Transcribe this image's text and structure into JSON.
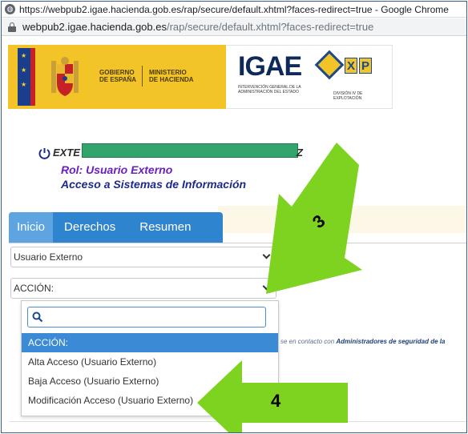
{
  "window": {
    "title": "https://webpub2.igae.hacienda.gob.es/rap/secure/default.xhtml?faces-redirect=true - Google Chrome"
  },
  "address": {
    "host": "webpub2.igae.hacienda.gob.es",
    "path": "/rap/secure/default.xhtml?faces-redirect=true"
  },
  "banner": {
    "gov_line1": "GOBIERNO",
    "gov_line2": "DE ESPAÑA",
    "min_line1": "MINISTERIO",
    "min_line2": "DE HACIENDA",
    "igae_logo": "IGAE",
    "igae_sub": "INTERVENCIÓN GENERAL DE LA ADMINISTRACIÓN DEL ESTADO",
    "dexp_letters": [
      "X",
      "P"
    ],
    "dexp_sub": "DIVISIÓN IV DE EXPLOTACIÓN"
  },
  "user": {
    "name_prefix": "EXTE",
    "name_suffix": "Z",
    "rol": "Rol: Usuario Externo",
    "acceso": "Acceso a Sistemas de Información"
  },
  "tabs": [
    {
      "label": "Inicio",
      "active": true
    },
    {
      "label": "Derechos",
      "active": false
    },
    {
      "label": "Resumen",
      "active": false
    }
  ],
  "user_type_select": {
    "value": "Usuario Externo"
  },
  "accion_select": {
    "value": "ACCIÓN:"
  },
  "dropdown": {
    "search_placeholder": "",
    "options": [
      {
        "label": "ACCIÓN:",
        "highlighted": true
      },
      {
        "label": "Alta Acceso (Usuario Externo)",
        "highlighted": false
      },
      {
        "label": "Baja Acceso (Usuario Externo)",
        "highlighted": false
      },
      {
        "label": "Modificación Acceso (Usuario Externo)",
        "highlighted": false
      }
    ]
  },
  "contact": {
    "prefix": "se en contacto con",
    "link": "Administradores de seguridad de la"
  },
  "annotations": [
    {
      "number": "3",
      "color": "#7ed321"
    },
    {
      "number": "4",
      "color": "#7ed321"
    }
  ],
  "colors": {
    "tab_bar": "#2f84d0",
    "tab_active": "#5da4e0",
    "highlight": "#3b8ad6",
    "rol_text": "#6b1fbf",
    "acceso_text": "#1d2a8c",
    "arrow_green": "#7ed321"
  }
}
